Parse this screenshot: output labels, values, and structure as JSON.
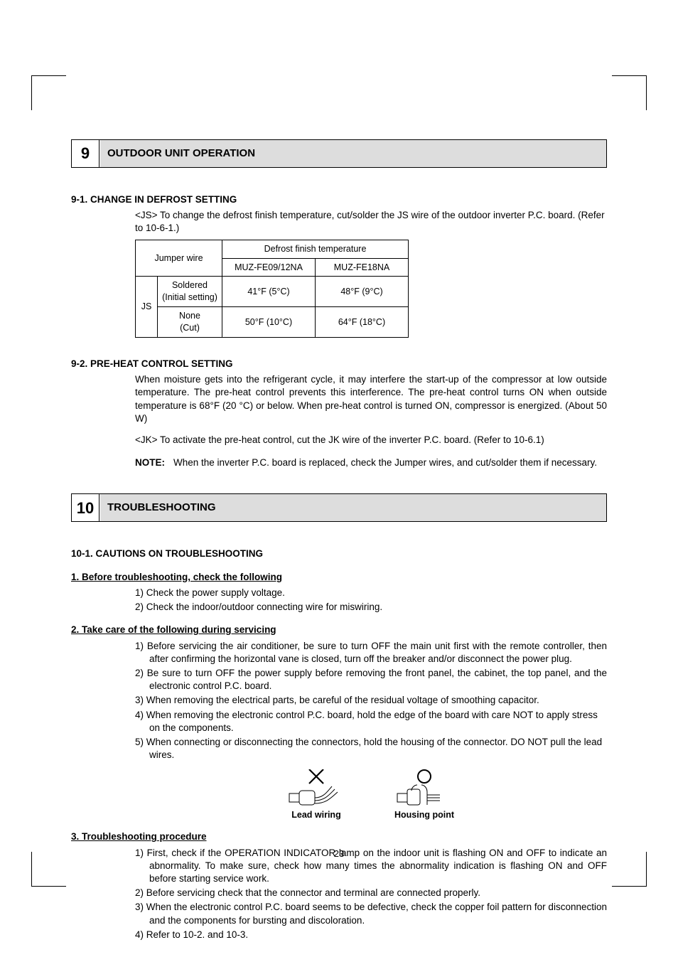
{
  "sectionA": {
    "num": "9",
    "title": "OUTDOOR UNIT OPERATION",
    "sub_defrost": "9-1. CHANGE IN DEFROST SETTING",
    "defrost_intro": "<JS> To change the defrost finish temperature, cut/solder the JS wire of the outdoor inverter P.C. board. (Refer to 10-6-1.)",
    "table": {
      "h1": "Jumper wire",
      "h2": "Defrost finish temperature",
      "h2a": "MUZ-FE09/12NA",
      "h2b": "MUZ-FE18NA",
      "rowLabel": "JS",
      "r1a": "Soldered\n(Initial setting)",
      "r1b": "41°F (5°C)",
      "r1c": "48°F (9°C)",
      "r2a": "None\n(Cut)",
      "r2b": "50°F (10°C)",
      "r2c": "64°F (18°C)"
    },
    "sub_preheat": "9-2. PRE-HEAT CONTROL SETTING",
    "preheat_para": "When moisture gets into the refrigerant cycle, it may interfere the start-up of the compressor at low outside temperature. The pre-heat control prevents this interference. The pre-heat control turns ON when outside temperature is 68°F (20 °C) or below. When pre-heat control is turned ON, compressor is energized. (About 50 W)",
    "jk_line": "<JK> To activate the pre-heat control, cut the JK wire of the inverter P.C. board. (Refer to 10-6.1)",
    "note_label": "NOTE:",
    "note_text": "When the inverter P.C. board is replaced, check the Jumper wires, and cut/solder them if necessary."
  },
  "sectionB": {
    "num": "10",
    "title": "TROUBLESHOOTING",
    "sub": "10-1. CAUTIONS ON TROUBLESHOOTING",
    "h_before": "1. Before troubleshooting, check the following",
    "before": [
      "1) Check the power supply voltage.",
      "2) Check the indoor/outdoor connecting wire for miswiring."
    ],
    "h_caution": "2. Take care of the following during servicing",
    "caution": [
      "1) Before servicing the air conditioner, be sure to turn OFF the main unit first with the remote controller, then after confirming the horizontal vane is closed, turn off the breaker and/or disconnect the power plug.",
      "2) Be sure to turn OFF the power supply before removing the front panel, the cabinet, the top panel, and the electronic control P.C. board.",
      "3) When removing the electrical parts, be careful of the residual voltage of smoothing capacitor.",
      "4) When removing the electronic control P.C. board, hold the edge of the board with care NOT to apply stress on the components.",
      "5) When connecting or disconnecting the connectors, hold the housing of the connector. DO NOT pull the lead wires."
    ],
    "fig_bad": "Lead wiring",
    "fig_good": "Housing point",
    "h_procedure": "3. Troubleshooting procedure",
    "procedure": [
      "1) First, check if the OPERATION INDICATOR lamp on the indoor unit is flashing ON and OFF to indicate an abnormality. To make sure, check how many times the abnormality indication is flashing ON and OFF before starting service work.",
      "2) Before servicing check that the connector and terminal are connected properly.",
      "3) When the electronic control P.C. board seems to be defective, check the copper foil pattern for disconnection and the components for bursting and discoloration.",
      "4) Refer to 10-2. and 10-3."
    ]
  },
  "pageNumber": "23"
}
